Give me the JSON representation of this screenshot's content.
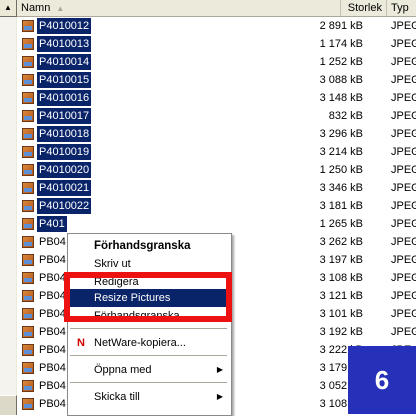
{
  "header": {
    "name": "Namn",
    "size": "Storlek",
    "type": "Typ"
  },
  "files": [
    {
      "name": "P4010012",
      "size": "2 891 kB",
      "type": "JPEG-bild",
      "selected": true
    },
    {
      "name": "P4010013",
      "size": "1 174 kB",
      "type": "JPEG-bild",
      "selected": true
    },
    {
      "name": "P4010014",
      "size": "1 252 kB",
      "type": "JPEG-bild",
      "selected": true
    },
    {
      "name": "P4010015",
      "size": "3 088 kB",
      "type": "JPEG-bild",
      "selected": true
    },
    {
      "name": "P4010016",
      "size": "3 148 kB",
      "type": "JPEG-bild",
      "selected": true
    },
    {
      "name": "P4010017",
      "size": "832 kB",
      "type": "JPEG-bild",
      "selected": true
    },
    {
      "name": "P4010018",
      "size": "3 296 kB",
      "type": "JPEG-bild",
      "selected": true
    },
    {
      "name": "P4010019",
      "size": "3 214 kB",
      "type": "JPEG-bild",
      "selected": true
    },
    {
      "name": "P4010020",
      "size": "1 250 kB",
      "type": "JPEG-bild",
      "selected": true
    },
    {
      "name": "P4010021",
      "size": "3 346 kB",
      "type": "JPEG-bild",
      "selected": true
    },
    {
      "name": "P4010022",
      "size": "3 181 kB",
      "type": "JPEG-bild",
      "selected": true
    },
    {
      "name": "P401",
      "size": "1 265 kB",
      "type": "JPEG-bild",
      "selected": true
    },
    {
      "name": "PB04",
      "size": "3 262 kB",
      "type": "JPEG-bild",
      "selected": false
    },
    {
      "name": "PB04",
      "size": "3 197 kB",
      "type": "JPEG-bild",
      "selected": false
    },
    {
      "name": "PB04",
      "size": "3 108 kB",
      "type": "JPEG-bild",
      "selected": false
    },
    {
      "name": "PB04",
      "size": "3 121 kB",
      "type": "JPEG-bild",
      "selected": false
    },
    {
      "name": "PB04",
      "size": "3 101 kB",
      "type": "JPEG-bild",
      "selected": false
    },
    {
      "name": "PB04",
      "size": "3 192 kB",
      "type": "JPEG-bild",
      "selected": false
    },
    {
      "name": "PB04",
      "size": "3 222 kB",
      "type": "JPE",
      "selected": false
    },
    {
      "name": "PB04",
      "size": "3 179 kB",
      "type": "JPE",
      "selected": false
    },
    {
      "name": "PB04",
      "size": "3 052 kB",
      "type": "JPE",
      "selected": false
    },
    {
      "name": "PB04",
      "size": "3 108 kB",
      "type": "JPE",
      "selected": false
    }
  ],
  "context_menu": {
    "preview": "Förhandsgranska",
    "print": "Skriv ut",
    "edit": "Redigera",
    "resize": "Resize Pictures",
    "preview2": "Förhandsgranska",
    "netware_copy": "NetWare-kopiera...",
    "open_with": "Öppna med",
    "send_to": "Skicka till"
  },
  "step_badge": "6",
  "colors": {
    "selection": "#0a246a",
    "highlight_box": "#ee1111",
    "badge": "#2630b8"
  }
}
